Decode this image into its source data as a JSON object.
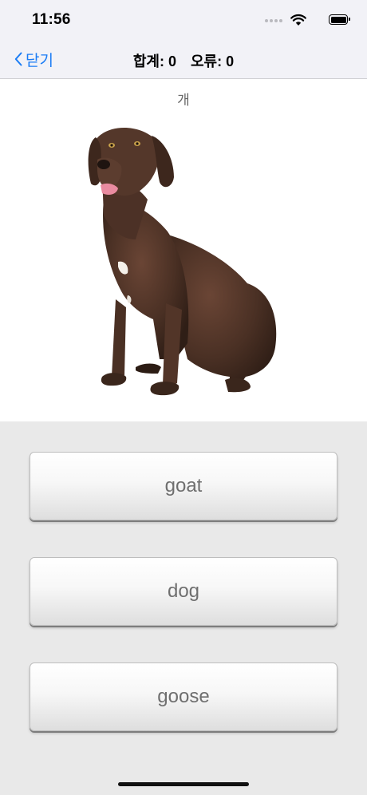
{
  "status_bar": {
    "time": "11:56"
  },
  "nav": {
    "back_label": "닫기",
    "total_label": "합계: 0",
    "errors_label": "오류: 0"
  },
  "quiz": {
    "prompt_word": "개",
    "image_subject": "dog",
    "answers": [
      {
        "label": "goat"
      },
      {
        "label": "dog"
      },
      {
        "label": "goose"
      }
    ]
  },
  "colors": {
    "accent": "#1a7cf5",
    "page_background": "#e9e9e9",
    "dog_coat": "#4a3024"
  }
}
